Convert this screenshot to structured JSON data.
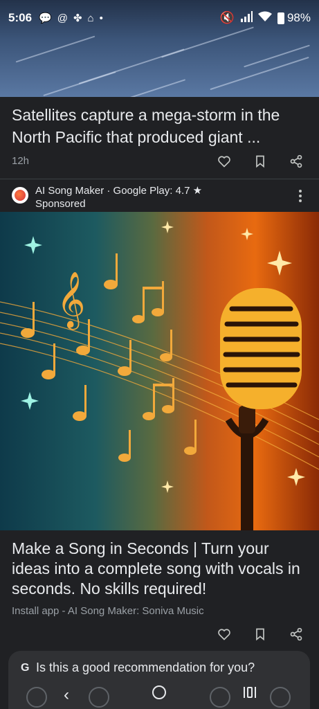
{
  "status_bar": {
    "time": "5:06",
    "battery": "98%",
    "notification_icons": [
      "chat-icon",
      "threads-icon",
      "pinwheel-icon",
      "home-icon",
      "dot-icon"
    ],
    "system_icons": [
      "mute-icon",
      "signal-icon",
      "wifi-icon",
      "battery-icon"
    ]
  },
  "article1": {
    "title": "Satellites capture a mega-storm in the North Pacific that produced giant ...",
    "age": "12h"
  },
  "ad": {
    "advertiser": "AI Song Maker · Google Play: 4.7 ★",
    "sponsored_label": "Sponsored",
    "title": "Make a Song in Seconds | Turn your ideas into a complete song with vocals in seconds. No skills required!",
    "install_text": "Install app - AI Song Maker: Soniva Music"
  },
  "recommendation": {
    "g_label": "G",
    "question": "Is this a good recommendation for you?"
  },
  "colors": {
    "background": "#202124",
    "text_primary": "#e8eaed",
    "text_secondary": "#9aa0a6",
    "card": "#303134"
  }
}
